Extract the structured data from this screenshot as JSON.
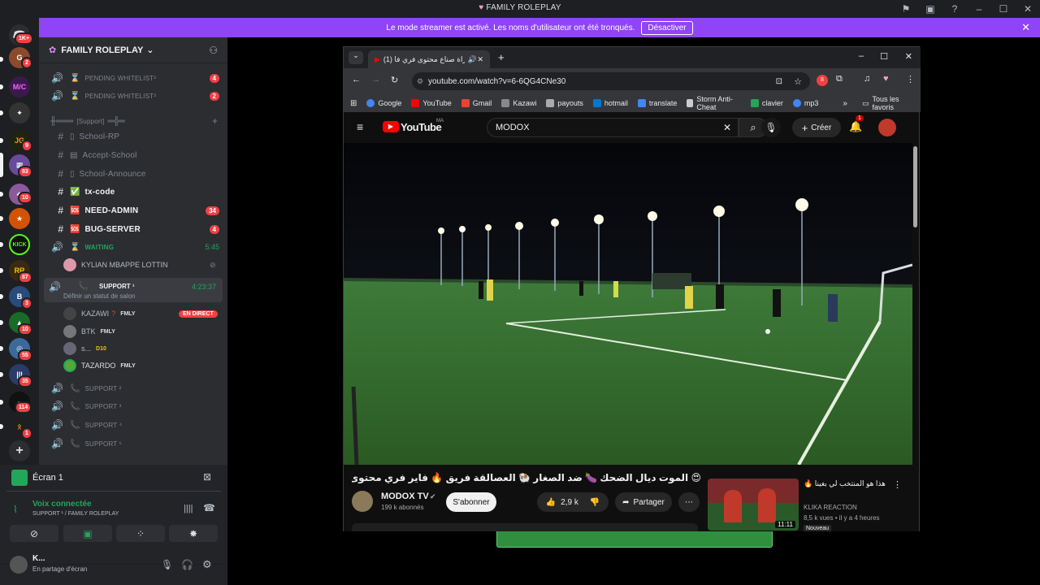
{
  "window": {
    "title": "FAMILY ROLEPLAY"
  },
  "banner": {
    "text": "Le mode streamer est activé. Les noms d'utilisateur ont été tronqués.",
    "button": "Désactiver"
  },
  "rail": {
    "badges": [
      "1K+",
      "2",
      "9",
      "83",
      "10",
      "87",
      "3",
      "10",
      "55",
      "35",
      "114",
      "1"
    ],
    "kick_label": "KICK"
  },
  "server": {
    "name": "FAMILY ROLEPLAY",
    "channels": [
      {
        "name": "PENDING WHITELIST²",
        "badge": "4"
      },
      {
        "name": "PENDING WHITELIST³",
        "badge": "2"
      },
      {
        "name": "[Support]"
      },
      {
        "name": "School-RP"
      },
      {
        "name": "Accept-School"
      },
      {
        "name": "School-Announce"
      },
      {
        "name": "tx-code"
      },
      {
        "name": "NEED-ADMIN",
        "badge": "34"
      },
      {
        "name": "BUG-SERVER",
        "badge": "4"
      },
      {
        "name": "WAITING",
        "time": "5:45"
      },
      {
        "name": "SUPPORT ¹",
        "time": "4:23:37",
        "status": "Définir un statut de salon"
      },
      {
        "name": "SUPPORT ²"
      },
      {
        "name": "SUPPORT ³"
      },
      {
        "name": "SUPPORT ⁴"
      },
      {
        "name": "SUPPORT ⁵"
      }
    ],
    "users": [
      {
        "name": "KYLIAN MBAPPE LOTTIN"
      },
      {
        "name": "KAZAWI",
        "tag": "FMLY",
        "live": "EN DIRECT"
      },
      {
        "name": "BTK",
        "tag": "FMLY"
      },
      {
        "name": "s...",
        "tag": "D10"
      },
      {
        "name": "TAZARDO",
        "tag": "FMLY"
      }
    ]
  },
  "bottom": {
    "screen_title": "Écran 1",
    "voice_status": "Voix connectée",
    "voice_channel": "SUPPORT ¹ / FAMILY ROLEPLAY",
    "user_name": "K...",
    "user_status": "En partage d'écran"
  },
  "browser": {
    "tab_title": "(1) مباراة صناع محتوى فري فا",
    "url": "youtube.com/watch?v=6-6QG4CNe30",
    "ext_badge": "8",
    "bookmarks": [
      "Google",
      "YouTube",
      "Gmail",
      "Kazawi",
      "payouts",
      "hotmail",
      "translate",
      "Storm Anti-Cheat",
      "clavier",
      "mp3"
    ],
    "all_bookmarks": "Tous les favoris"
  },
  "youtube": {
    "logo": "YouTube",
    "region": "MA",
    "search_value": "MODOX",
    "create_label": "Créer",
    "notif_count": "1",
    "video_title": "😍 الموت ديال الضحك 🍆 ضد الصغار 🐏 العصالقة فريق 🔥 فاير فري محتوى صناع مباراة",
    "channel": "MODOX TV",
    "subscribers": "199 k abonnés",
    "subscribe": "S'abonner",
    "likes": "2,9 k",
    "share": "Partager",
    "related": {
      "title": "هذا هو المنتخب لي بغينا 🔥",
      "channel": "KLIKA REACTION",
      "meta": "8,5 k vues • il y a 4 heures",
      "badge": "Nouveau",
      "duration": "11:11"
    }
  },
  "colors": {
    "discord_bg": "#1e1f22",
    "sidebar_bg": "#2b2d31",
    "banner": "#9044f7",
    "green": "#23a55a",
    "red": "#f23f43"
  }
}
